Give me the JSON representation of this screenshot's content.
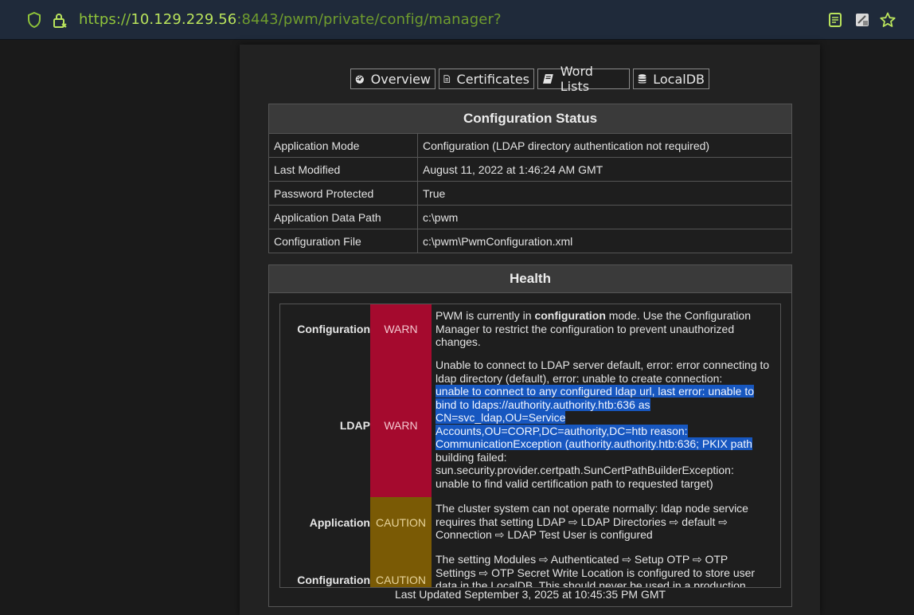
{
  "browser": {
    "url_scheme": "https://",
    "url_host": "10.129.229.56",
    "url_rest": ":8443/pwm/private/config/manager?"
  },
  "tabs": [
    {
      "label": "Overview",
      "icon": "dashboard-icon"
    },
    {
      "label": "Certificates",
      "icon": "document-icon"
    },
    {
      "label": "Word Lists",
      "icon": "book-icon"
    },
    {
      "label": "LocalDB",
      "icon": "database-icon"
    }
  ],
  "config_status": {
    "title": "Configuration Status",
    "rows": [
      {
        "key": "Application Mode",
        "value": "Configuration (LDAP directory authentication not required)"
      },
      {
        "key": "Last Modified",
        "value": "August 11, 2022 at 1:46:24 AM GMT"
      },
      {
        "key": "Password Protected",
        "value": "True"
      },
      {
        "key": "Application Data Path",
        "value": "c:\\pwm"
      },
      {
        "key": "Configuration File",
        "value": "c:\\pwm\\PwmConfiguration.xml"
      }
    ]
  },
  "health": {
    "title": "Health",
    "items": [
      {
        "topic": "Configuration",
        "status": "WARN",
        "msg_pre": "PWM is currently in ",
        "msg_bold": "configuration",
        "msg_post": " mode. Use the Configuration Manager to restrict the configuration to prevent unauthorized changes."
      },
      {
        "topic": "LDAP",
        "status": "WARN",
        "msg_a": "Unable to connect to LDAP server default, error: error connecting to ldap directory (default), error: unable to create connection:",
        "msg_hl_1": "unable to connect to any configured ldap url, last error: unable to",
        "msg_hl_2": "bind to ldaps://authority.authority.htb:636 as",
        "msg_hl_3": "CN=svc_ldap,OU=Service",
        "msg_hl_4": "Accounts,OU=CORP,DC=authority,DC=htb reason:",
        "msg_hl_5": "CommunicationException (authority.authority.htb:636; PKIX path",
        "msg_b": "building failed: sun.security.provider.certpath.SunCertPathBuilderException: unable to find valid certification path to requested target)"
      },
      {
        "topic": "Application",
        "status": "CAUTION",
        "msg": "The cluster system can not operate normally: ldap node service requires that setting LDAP ⇨ LDAP Directories ⇨ default ⇨ Connection ⇨ LDAP Test User is configured"
      },
      {
        "topic": "Configuration",
        "status": "CAUTION",
        "msg": "The setting Modules ⇨ Authenticated ⇨ Setup OTP ⇨ OTP Settings ⇨ OTP Secret Write Location is configured to store user data in the LocalDB. This should never be used in a production"
      }
    ],
    "last_updated": "Last Updated September 3, 2025 at 10:45:35 PM GMT"
  },
  "colors": {
    "warn": "#a50a2e",
    "caution": "#7a5a05",
    "selection": "#1757c0",
    "url_green": "#8fc43a"
  }
}
